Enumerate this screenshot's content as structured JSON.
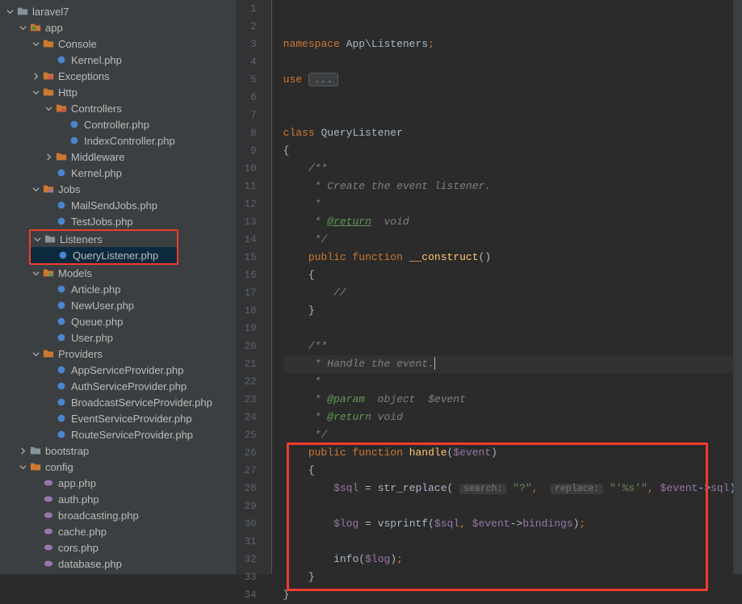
{
  "tree": {
    "root": "laravel7",
    "app": "app",
    "console": "Console",
    "kernel1": "Kernel.php",
    "exceptions": "Exceptions",
    "http": "Http",
    "controllers": "Controllers",
    "controller": "Controller.php",
    "indexcontroller": "IndexController.php",
    "middleware": "Middleware",
    "kernel2": "Kernel.php",
    "jobs": "Jobs",
    "mailsendjobs": "MailSendJobs.php",
    "testjobs": "TestJobs.php",
    "listeners": "Listeners",
    "querylistener": "QueryListener.php",
    "models": "Models",
    "article": "Article.php",
    "newuser": "NewUser.php",
    "queue": "Queue.php",
    "user": "User.php",
    "providers": "Providers",
    "appsp": "AppServiceProvider.php",
    "authsp": "AuthServiceProvider.php",
    "broadcastsp": "BroadcastServiceProvider.php",
    "eventsp": "EventServiceProvider.php",
    "routesp": "RouteServiceProvider.php",
    "bootstrap": "bootstrap",
    "config": "config",
    "cfg_app": "app.php",
    "cfg_auth": "auth.php",
    "cfg_broadcasting": "broadcasting.php",
    "cfg_cache": "cache.php",
    "cfg_cors": "cors.php",
    "cfg_database": "database.php"
  },
  "code": {
    "ns_kw": "namespace ",
    "ns_val": "App\\Listeners",
    "use_kw": "use ",
    "fold": "...",
    "class_kw": "class ",
    "class_name": "QueryListener",
    "c_create": " * Create the event listener.",
    "c_star": " *",
    "c_open": "/**",
    "c_close": " */",
    "c_ret": " * ",
    "tag_return": "@return",
    "tag_param": "@param",
    "ret_void": "  void",
    "param_obj": "  object  $event",
    "pub_fn": "public function ",
    "construct": "__construct",
    "handle": "handle",
    "handle_evt": " * Handle the event.",
    "sql_var": "$sql",
    "log_var": "$log",
    "event_var": "$event",
    "str_replace": "str_replace",
    "vsprintf": "vsprintf",
    "info": "info",
    "sql_prop": "sql",
    "bindings_prop": "bindings",
    "hint_search": "search:",
    "hint_replace": "replace:",
    "str_q": "\"?\"",
    "str_s": "\"'%s'\"",
    "slash": "//"
  },
  "line_start": 1
}
